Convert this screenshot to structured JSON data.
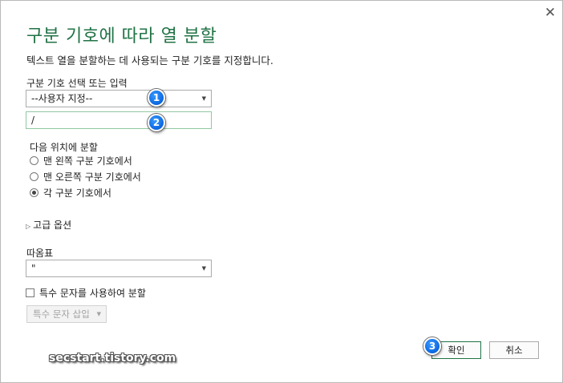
{
  "dialog": {
    "close_glyph": "✕",
    "title": "구분 기호에 따라 열 분할",
    "description": "텍스트 열을 분할하는 데 사용되는 구분 기호를 지정합니다."
  },
  "delimiter": {
    "label": "구분 기호 선택 또는 입력",
    "selected": "--사용자 지정--",
    "custom_value": "/"
  },
  "split_at": {
    "label": "다음 위치에 분할",
    "options": [
      {
        "label": "맨 왼쪽 구분 기호에서",
        "checked": false
      },
      {
        "label": "맨 오른쪽 구분 기호에서",
        "checked": false
      },
      {
        "label": "각 구분 기호에서",
        "checked": true
      }
    ]
  },
  "advanced": {
    "label": "고급 옵션"
  },
  "quote": {
    "label": "따옴표",
    "selected": "\""
  },
  "special_chars": {
    "checkbox_label": "특수 문자를 사용하여 분할",
    "checked": false,
    "insert_button": "특수 문자 삽입"
  },
  "buttons": {
    "ok": "확인",
    "cancel": "취소"
  },
  "annotations": {
    "badge1": "1",
    "badge2": "2",
    "badge3": "3"
  },
  "watermark": "secstart.tistory.com",
  "colors": {
    "accent": "#217346",
    "badge": "#0a66e0"
  }
}
